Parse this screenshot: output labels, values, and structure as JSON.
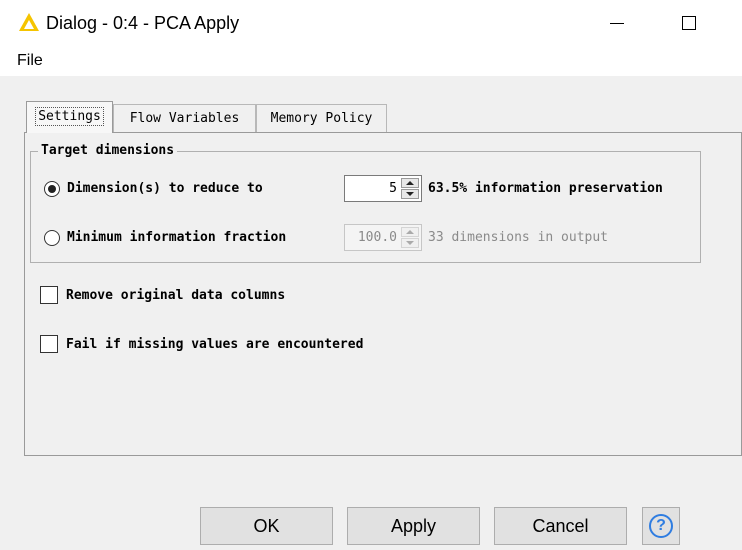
{
  "window": {
    "title": "Dialog - 0:4 - PCA Apply",
    "logo_icon": "knime-triangle-icon",
    "accent_color": "#f5c400"
  },
  "menu": {
    "file": "File"
  },
  "tabs": [
    {
      "label": "Settings",
      "selected": true
    },
    {
      "label": "Flow Variables",
      "selected": false
    },
    {
      "label": "Memory Policy",
      "selected": false
    }
  ],
  "target_dimensions": {
    "title": "Target dimensions",
    "dimensions_option": {
      "label": "Dimension(s) to reduce to",
      "selected": true,
      "value": "5",
      "info": "63.5% information preservation"
    },
    "fraction_option": {
      "label": "Minimum information fraction",
      "selected": false,
      "value": "100.0",
      "info": "33 dimensions in output"
    }
  },
  "options": {
    "remove_columns": {
      "label": "Remove original data columns",
      "checked": false
    },
    "fail_missing": {
      "label": "Fail if missing values are encountered",
      "checked": false
    }
  },
  "buttons": {
    "ok": "OK",
    "apply": "Apply",
    "cancel": "Cancel",
    "help_glyph": "?",
    "help_icon": "help-circle-icon",
    "help_color": "#2f7de1"
  }
}
